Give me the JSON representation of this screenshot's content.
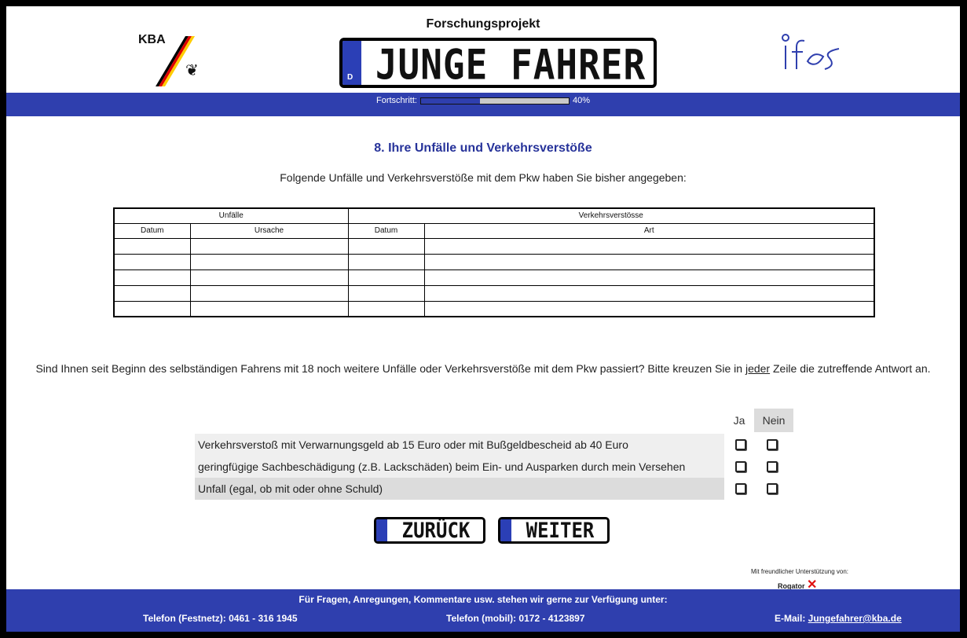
{
  "header": {
    "project_title": "Forschungsprojekt",
    "plate_text": "JUNGE FAHRER",
    "plate_country": "D",
    "kba_label": "KBA",
    "ifes_label": "ifes"
  },
  "progress": {
    "label": "Fortschritt:",
    "percent_text": "40%",
    "value": 0.4
  },
  "section": {
    "title": "8. Ihre Unfälle und Verkehrsverstöße",
    "intro": "Folgende Unfälle und Verkehrsverstöße mit dem Pkw haben Sie bisher angegeben:"
  },
  "table": {
    "group_unfaelle": "Unfälle",
    "group_verstoesse": "Verkehrsverstösse",
    "col_datum_1": "Datum",
    "col_ursache": "Ursache",
    "col_datum_2": "Datum",
    "col_art": "Art"
  },
  "question": {
    "text_before": "Sind Ihnen seit Beginn des selbständigen Fahrens mit 18 noch weitere Unfälle oder Verkehrsverstöße mit dem Pkw passiert? Bitte kreuzen Sie in ",
    "emphasis": "jeder",
    "text_after": " Zeile die zutreffende Antwort an."
  },
  "answers": {
    "ja": "Ja",
    "nein": "Nein",
    "items": [
      "Verkehrsverstoß mit Verwarnungsgeld ab 15 Euro oder mit Bußgeldbescheid ab 40 Euro",
      "geringfügige Sachbeschädigung (z.B. Lackschäden) beim Ein- und Ausparken durch mein Versehen",
      "Unfall (egal, ob mit oder ohne Schuld)"
    ]
  },
  "nav": {
    "back": "ZURÜCK",
    "next": "WEITER"
  },
  "support": {
    "text": "Mit freundlicher Unterstützung von:",
    "brand": "Rogator"
  },
  "footer": {
    "line1": "Für Fragen, Anregungen, Kommentare usw. stehen wir gerne zur Verfügung unter:",
    "phone_fixed": "Telefon (Festnetz): 0461 - 316 1945",
    "phone_mobile": "Telefon (mobil): 0172 - 4123897",
    "email_label": "E-Mail: ",
    "email": "Jungefahrer@kba.de"
  },
  "colors": {
    "brand_blue": "#2f3fae",
    "title_blue": "#27339a"
  }
}
